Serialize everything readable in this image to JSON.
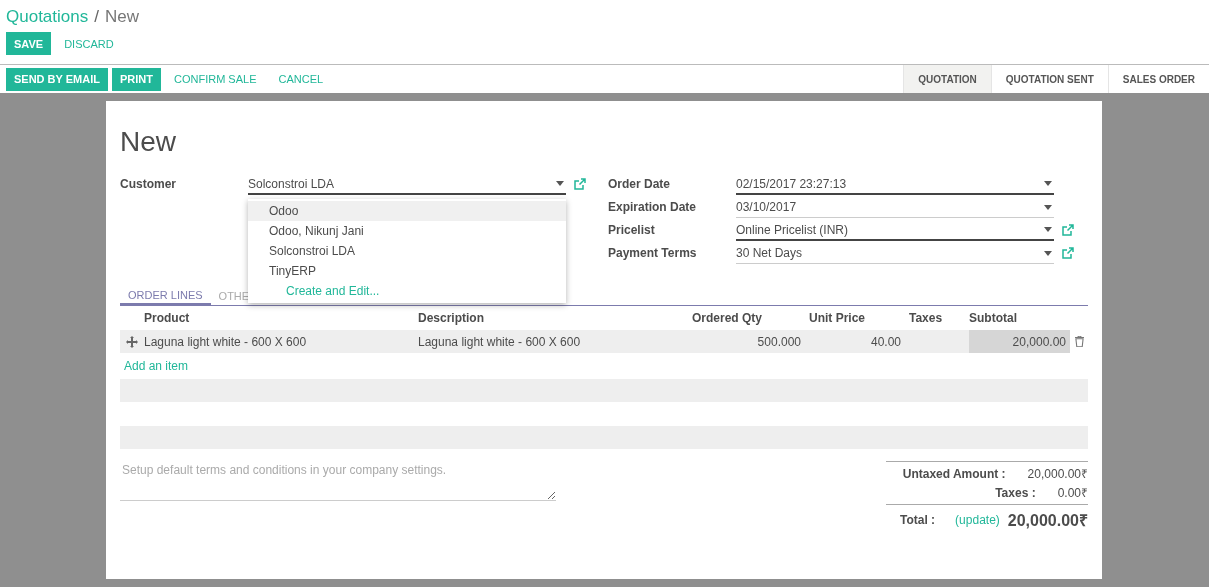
{
  "breadcrumb": {
    "parent": "Quotations",
    "separator": "/",
    "current": "New"
  },
  "edit_buttons": [
    {
      "label": "SAVE",
      "kind": "primary"
    },
    {
      "label": "DISCARD",
      "kind": "link"
    }
  ],
  "action_buttons": [
    {
      "label": "SEND BY EMAIL",
      "kind": "primary"
    },
    {
      "label": "PRINT",
      "kind": "primary"
    },
    {
      "label": "CONFIRM SALE",
      "kind": "link"
    },
    {
      "label": "CANCEL",
      "kind": "link"
    }
  ],
  "status_steps": [
    {
      "label": "QUOTATION",
      "selected": true
    },
    {
      "label": "QUOTATION SENT",
      "selected": false
    },
    {
      "label": "SALES ORDER",
      "selected": false
    }
  ],
  "form": {
    "title": "New",
    "left_fields": [
      {
        "label": "Customer",
        "value": "Solconstroi LDA",
        "required": true,
        "external_link": true
      }
    ],
    "customer_dropdown": [
      {
        "label": "Odoo",
        "kind": "option",
        "selected": true
      },
      {
        "label": "Odoo, Nikunj Jani",
        "kind": "option",
        "selected": false
      },
      {
        "label": "Solconstroi LDA",
        "kind": "option",
        "selected": false
      },
      {
        "label": "TinyERP",
        "kind": "option",
        "selected": false
      },
      {
        "label": "Create and Edit...",
        "kind": "action",
        "selected": false
      }
    ],
    "right_fields": [
      {
        "label": "Order Date",
        "value": "02/15/2017 23:27:13",
        "required": true,
        "external_link": false
      },
      {
        "label": "Expiration Date",
        "value": "03/10/2017",
        "required": false,
        "external_link": false
      },
      {
        "label": "Pricelist",
        "value": "Online Pricelist (INR)",
        "required": true,
        "external_link": true
      },
      {
        "label": "Payment Terms",
        "value": "30 Net Days",
        "required": false,
        "external_link": true
      }
    ],
    "tabs": [
      {
        "label": "ORDER LINES",
        "selected": true
      },
      {
        "label": "OTHE",
        "selected": false
      }
    ],
    "table": {
      "columns": [
        "Product",
        "Description",
        "Ordered Qty",
        "Unit Price",
        "Taxes",
        "Subtotal"
      ],
      "rows": [
        [
          "Laguna light white - 600 X 600",
          "Laguna light white - 600 X 600",
          "500.000",
          "40.00",
          "",
          "20,000.00"
        ]
      ],
      "add_item": "Add an item"
    },
    "notes": {
      "placeholder": "Setup default terms and conditions in your company settings."
    },
    "totals": [
      {
        "label": "Untaxed Amount :",
        "value": "20,000.00₹",
        "kind": "line"
      },
      {
        "label": "Taxes :",
        "value": "0.00₹",
        "kind": "line"
      },
      {
        "label": "Total :",
        "link": "(update)",
        "value": "20,000.00₹",
        "kind": "total"
      }
    ]
  }
}
